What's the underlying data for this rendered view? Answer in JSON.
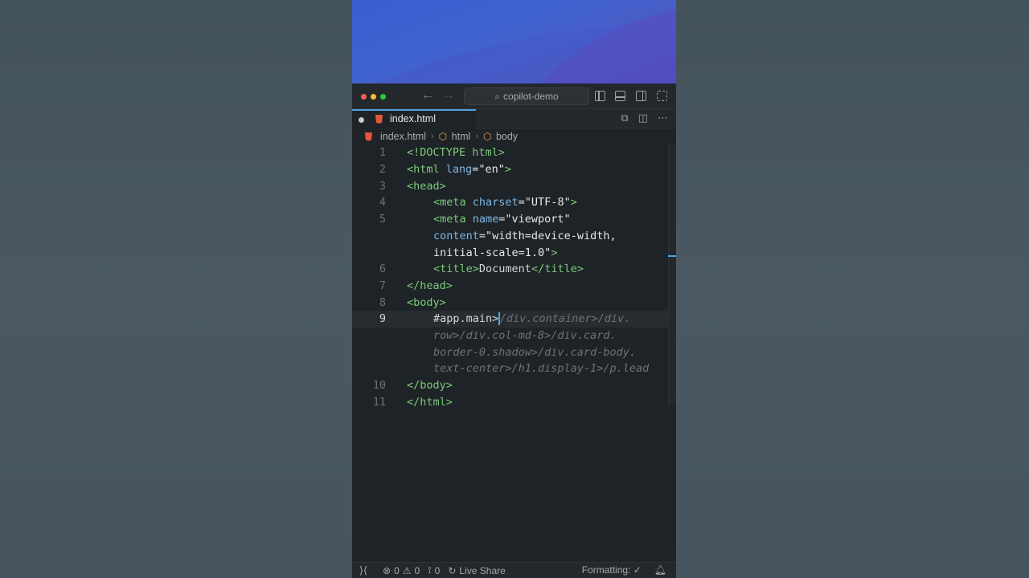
{
  "window": {
    "search": "copilot-demo"
  },
  "tabs": [
    {
      "label": "index.html",
      "icon": "html5-icon",
      "modified": true
    }
  ],
  "breadcrumb": {
    "file": "index.html",
    "html": "html",
    "body": "body"
  },
  "editor": {
    "lines": [
      {
        "n": "1"
      },
      {
        "n": "2"
      },
      {
        "n": "3"
      },
      {
        "n": "4"
      },
      {
        "n": "5"
      },
      {
        "n": "6"
      },
      {
        "n": "7"
      },
      {
        "n": "8"
      },
      {
        "n": "9"
      },
      {
        "n": "10"
      },
      {
        "n": "11"
      }
    ],
    "text": {
      "doctype": "<!DOCTYPE html>",
      "html_open_tag": "<html",
      "lang_attr": " lang",
      "lang_val": "=\"en\"",
      "close": ">",
      "head_open": "<head>",
      "meta1_tag": "<meta",
      "charset_attr": " charset",
      "charset_val": "=\"UTF-8\"",
      "meta2_tag": "<meta",
      "name_attr": " name",
      "name_val": "=\"viewport\"",
      "content_attr": "content",
      "content_val": "=\"width=device-width,",
      "content_val2": "initial-scale=1.0\"",
      "title_open": "<title>",
      "title_text": "Document",
      "title_close": "</title>",
      "head_close": "</head>",
      "body_open": "<body>",
      "typed": "#app.main>",
      "ghost1": "/div.container>/div.",
      "ghost2": "row>/div.col-md-8>/div.card.",
      "ghost3": "border-0.shadow>/div.card-body.",
      "ghost4": "text-center>/h1.display-1>/p.lead",
      "body_close": "</body>",
      "html_close": "</html>"
    }
  },
  "status": {
    "errors": "0",
    "warnings": "0",
    "ports": "0",
    "live_share": "Live Share",
    "formatting": "Formatting: ✓"
  },
  "colors": {
    "accent": "#4fa3e0",
    "tag": "#7ec97a",
    "attr": "#7fb6e6"
  }
}
